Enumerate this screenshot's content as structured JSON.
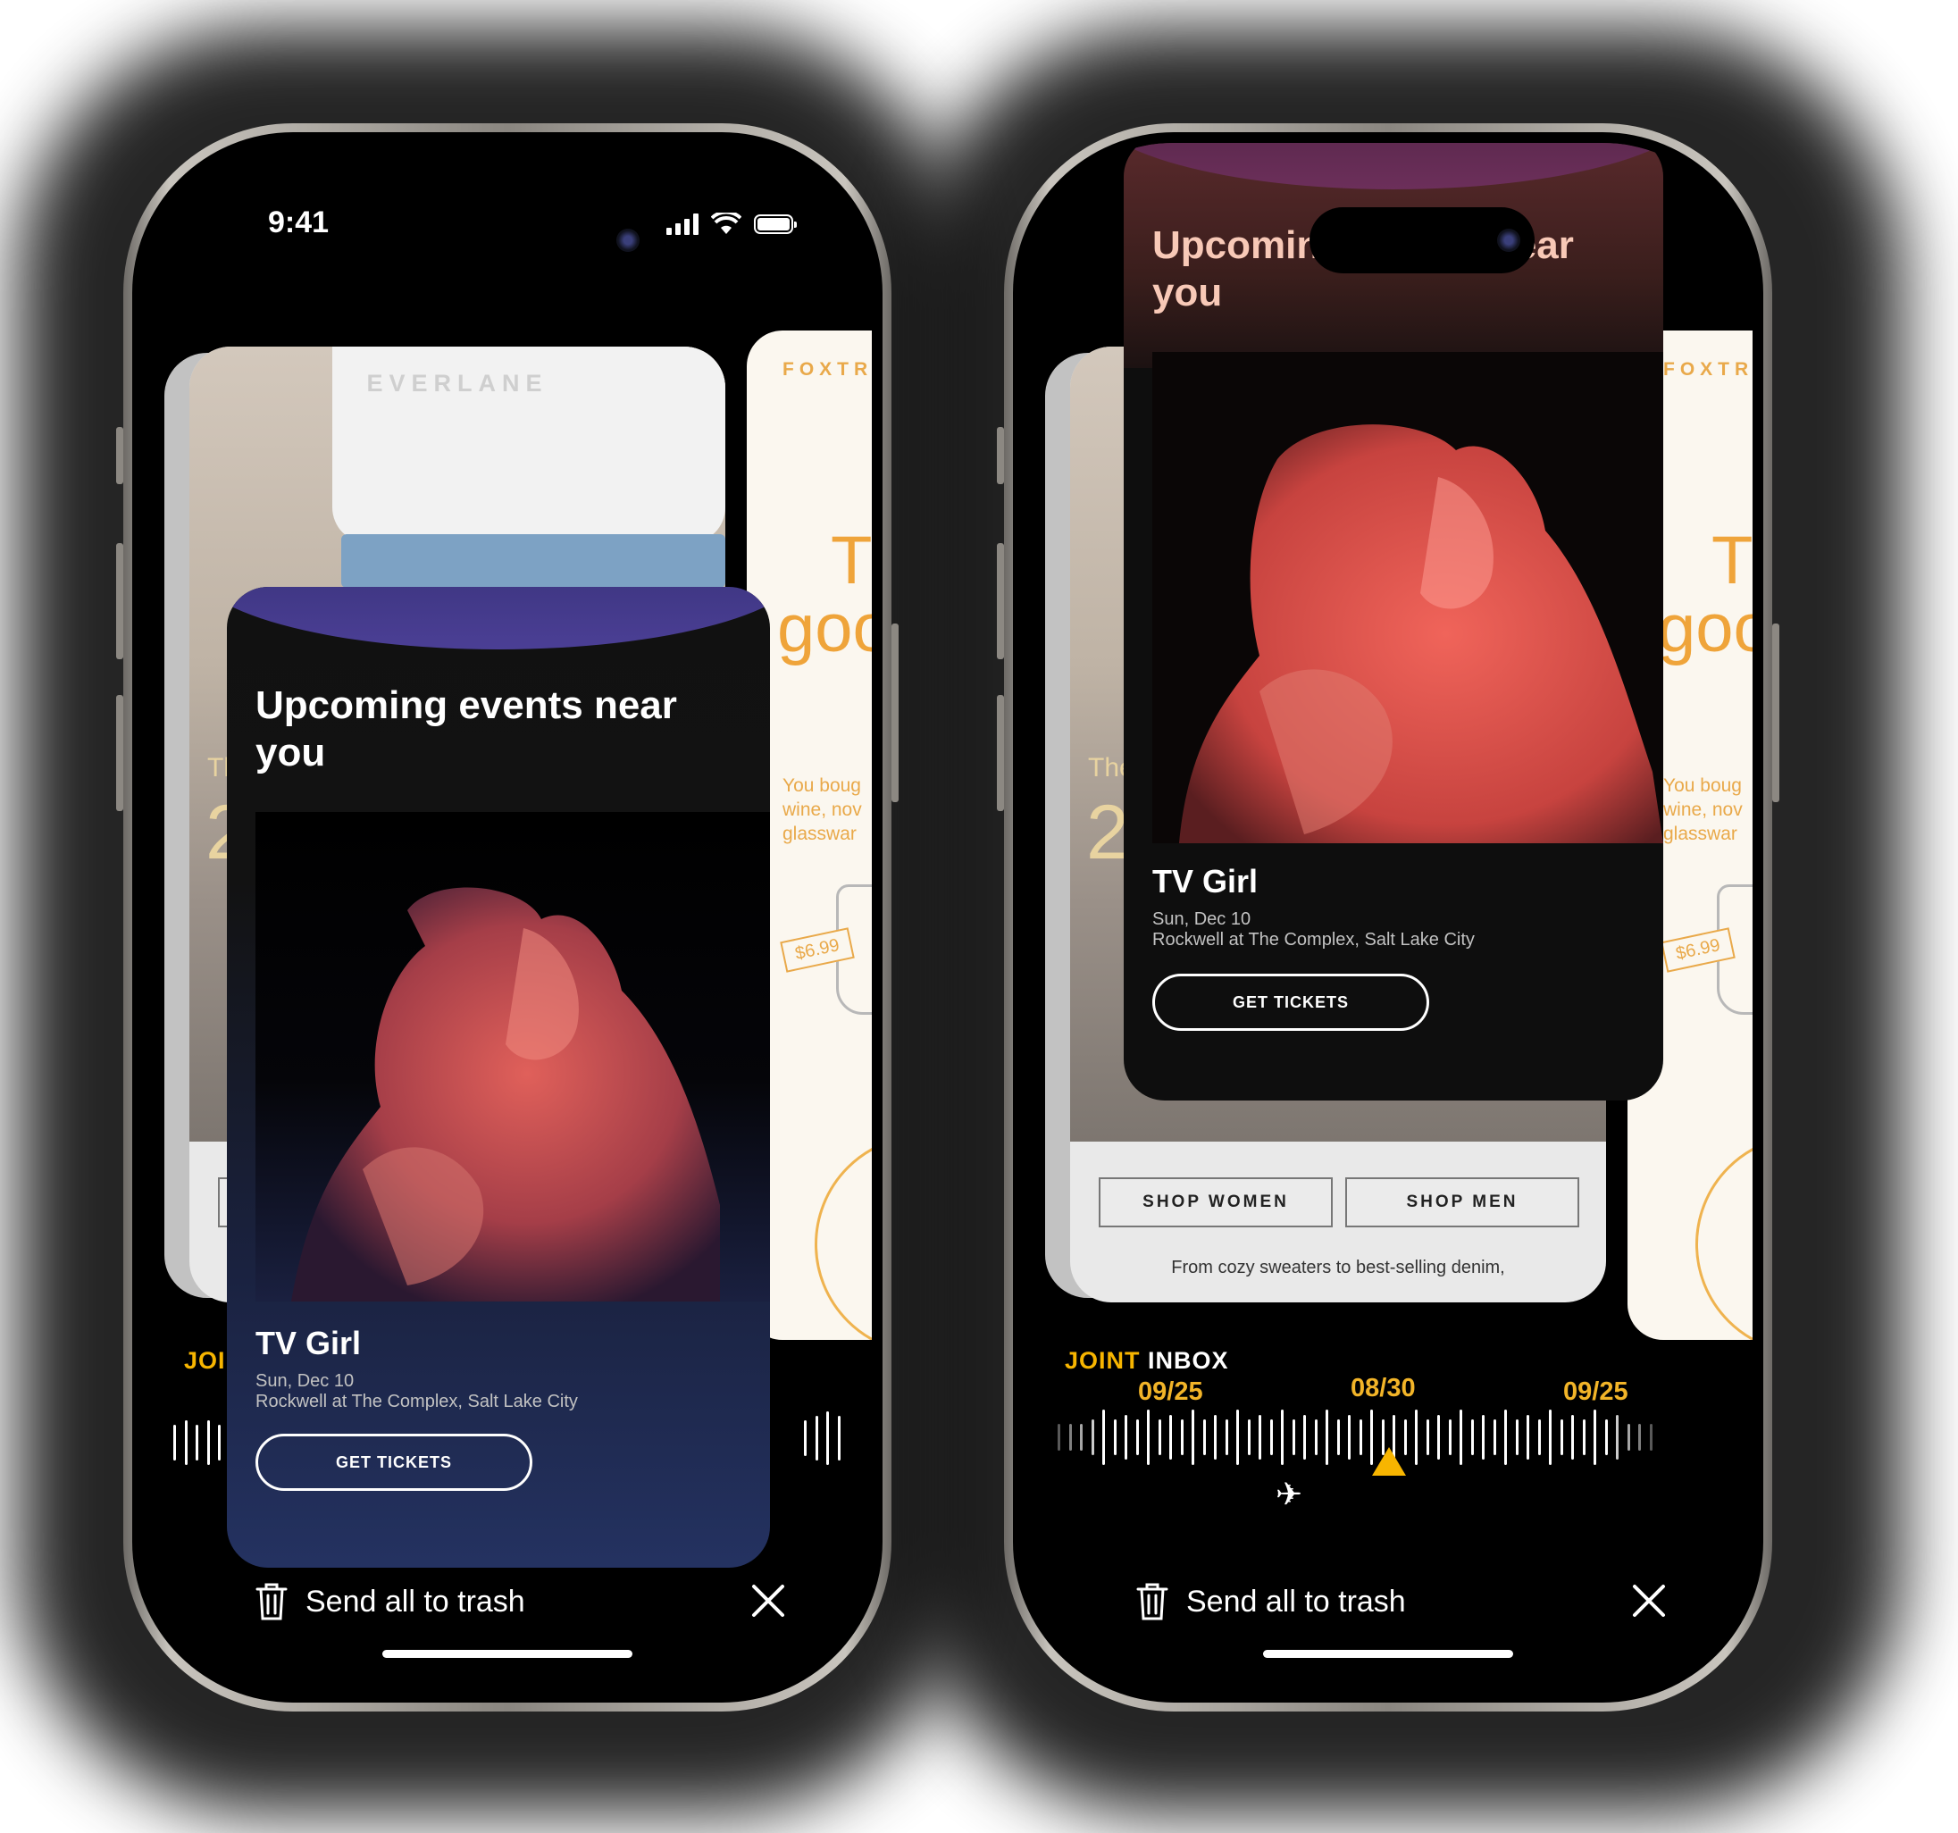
{
  "status_bar": {
    "time": "9:41"
  },
  "cards": {
    "everlane": {
      "logo": "EVERLANE",
      "headline_partial": "The",
      "number_partial": "2",
      "buttons": [
        "SHOP WOMEN",
        "SHOP MEN"
      ],
      "footer_text": "From cozy sweaters to best-selling denim,"
    },
    "foxtrot": {
      "logo_partial": "FOXTRO",
      "headline_line1": "Tl",
      "headline_line2": "goo",
      "body_lines": [
        "You boug",
        "wine, nov",
        "glasswar"
      ],
      "price": "$6.99"
    },
    "event": {
      "title": "Upcoming events near you",
      "artist": "TV Girl",
      "date": "Sun, Dec 10",
      "venue": "Rockwell at The Complex, Salt Lake City",
      "button": "GET TICKETS"
    }
  },
  "inbox": {
    "label_accent": "JOINT",
    "label_rest": "INBOX",
    "timeline_dates": [
      "09/25",
      "08/30",
      "09/25"
    ]
  },
  "footer": {
    "trash_label": "Send all to trash"
  },
  "colors": {
    "accent": "#f7b500",
    "date": "#f2b428",
    "foxtrot": "#efa43a"
  }
}
